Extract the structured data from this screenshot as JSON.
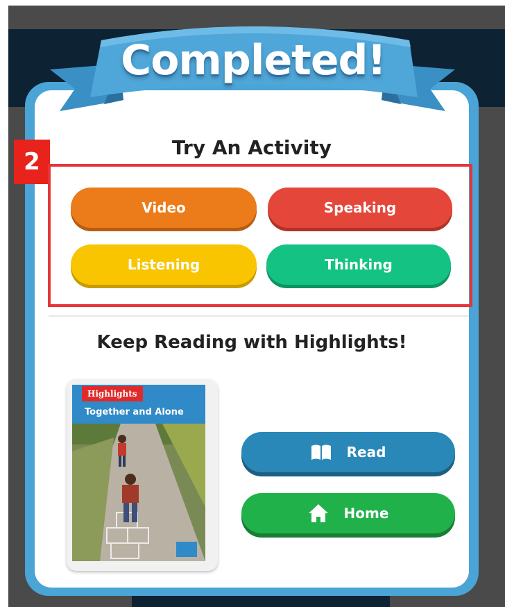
{
  "banner": {
    "title": "Completed!"
  },
  "annotation": {
    "step_number": "2"
  },
  "activities": {
    "heading": "Try An Activity",
    "buttons": [
      {
        "label": "Video",
        "color": "#ec7b1a"
      },
      {
        "label": "Speaking",
        "color": "#e5463a"
      },
      {
        "label": "Listening",
        "color": "#f8c500"
      },
      {
        "label": "Thinking",
        "color": "#14c383"
      }
    ]
  },
  "keep_reading": {
    "heading": "Keep Reading with Highlights!",
    "book": {
      "brand": "Highlights",
      "title": "Together and Alone"
    },
    "read_button": {
      "label": "Read",
      "icon": "book-open-icon",
      "color": "#2a88b8"
    },
    "home_button": {
      "label": "Home",
      "icon": "home-icon",
      "color": "#21b14a"
    }
  },
  "colors": {
    "frame": "#4aa4d6",
    "ribbon": "#4fa6d8",
    "highlight_box": "#e6353a"
  }
}
